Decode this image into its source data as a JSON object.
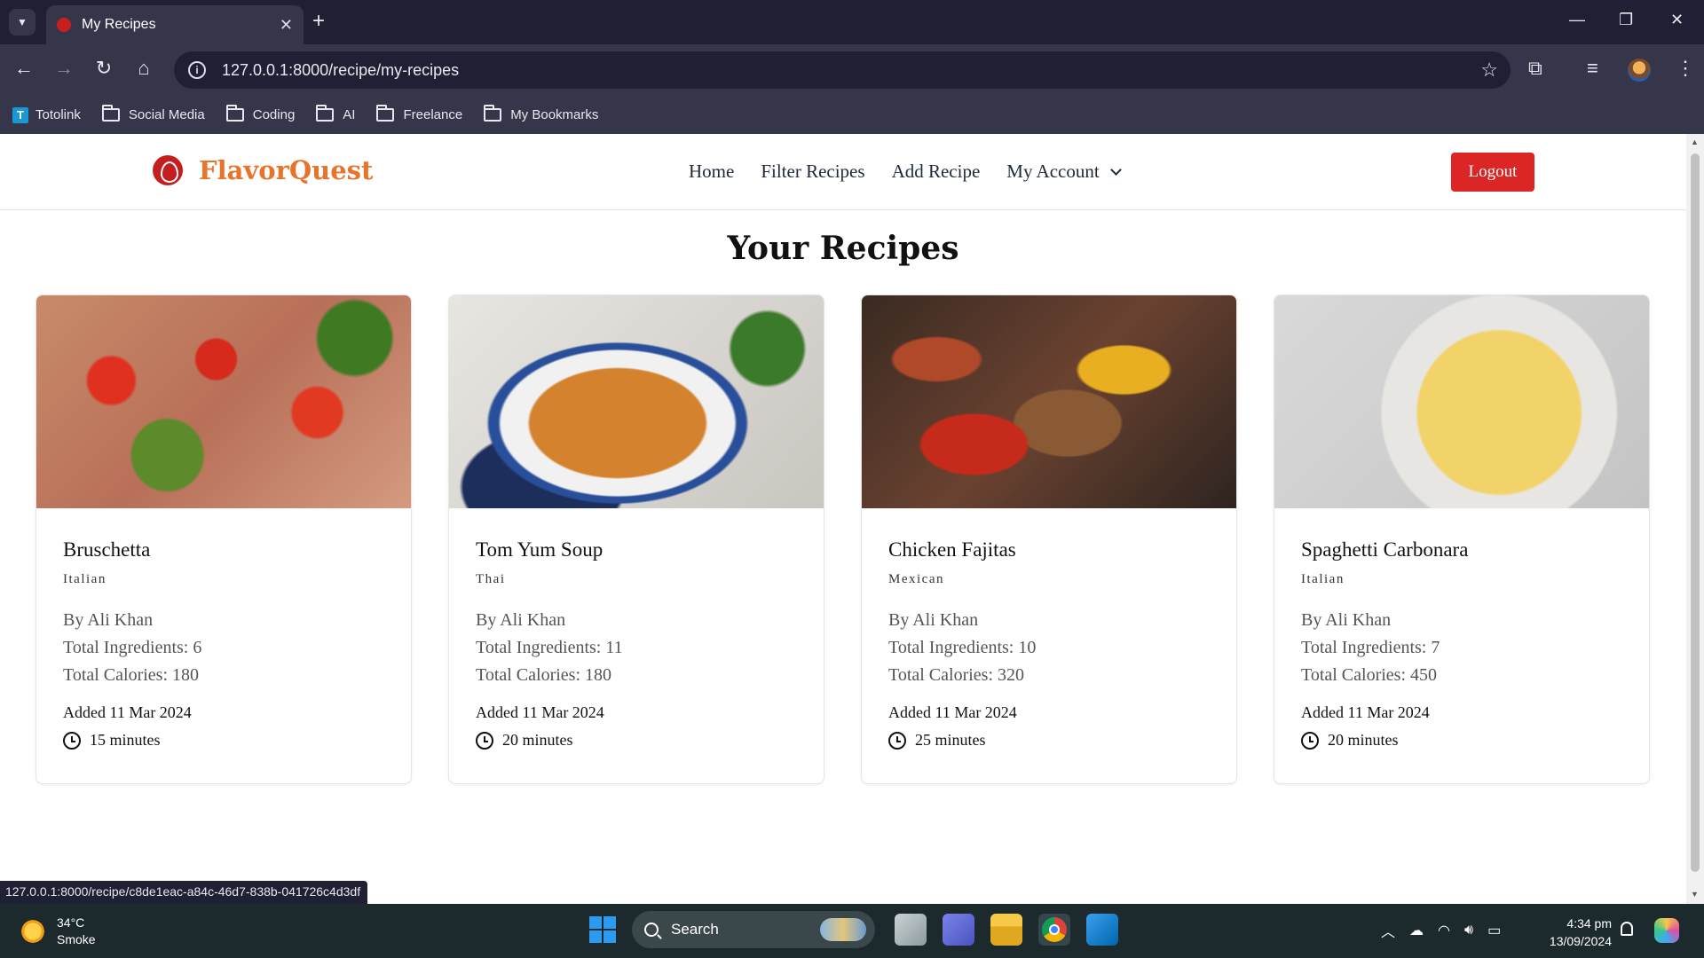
{
  "browser": {
    "tab_title": "My Recipes",
    "url": "127.0.0.1:8000/recipe/my-recipes",
    "bookmarks": [
      "Totolink",
      "Social Media",
      "Coding",
      "AI",
      "Freelance",
      "My Bookmarks"
    ],
    "status_url": "127.0.0.1:8000/recipe/c8de1eac-a84c-46d7-838b-041726c4d3df"
  },
  "site": {
    "brand": "FlavorQuest",
    "nav": [
      "Home",
      "Filter Recipes",
      "Add Recipe",
      "My Account"
    ],
    "logout_label": "Logout",
    "page_title": "Your Recipes",
    "accent_color": "#e8732a",
    "logout_color": "#dc2626"
  },
  "recipes": [
    {
      "title": "Bruschetta",
      "cuisine": "Italian",
      "author": "By Ali Khan",
      "ingredients": "Total Ingredients: 6",
      "calories": "Total Calories: 180",
      "added": "Added 11 Mar 2024",
      "time": "15 minutes"
    },
    {
      "title": "Tom Yum Soup",
      "cuisine": "Thai",
      "author": "By Ali Khan",
      "ingredients": "Total Ingredients: 11",
      "calories": "Total Calories: 180",
      "added": "Added 11 Mar 2024",
      "time": "20 minutes"
    },
    {
      "title": "Chicken Fajitas",
      "cuisine": "Mexican",
      "author": "By Ali Khan",
      "ingredients": "Total Ingredients: 10",
      "calories": "Total Calories: 320",
      "added": "Added 11 Mar 2024",
      "time": "25 minutes"
    },
    {
      "title": "Spaghetti Carbonara",
      "cuisine": "Italian",
      "author": "By Ali Khan",
      "ingredients": "Total Ingredients: 7",
      "calories": "Total Calories: 450",
      "added": "Added 11 Mar 2024",
      "time": "20 minutes"
    }
  ],
  "taskbar": {
    "temperature": "34°C",
    "weather": "Smoke",
    "search_label": "Search",
    "time": "4:34 pm",
    "date": "13/09/2024"
  }
}
